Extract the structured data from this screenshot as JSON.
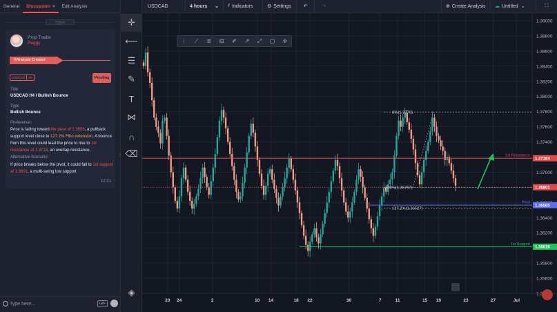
{
  "left_panel": {
    "tabs": [
      {
        "label": "General"
      },
      {
        "label": "Discussion",
        "close": "×"
      },
      {
        "label": "Edit Analysis"
      }
    ],
    "today_label": "TODAY",
    "post": {
      "role": "Prop Trader",
      "author": "Peggy",
      "banner": "Analysis Created",
      "symbol_tag": "USDCAD",
      "tf_tag": "H4",
      "status": "Pending",
      "title_label": "Title",
      "title": "USDCAD H4 I Bullish Bounce",
      "type_label": "Type",
      "type": "Bullish Bounce",
      "preference_label": "Preference:",
      "preference": [
        {
          "t": "Price is failing toward ",
          "c": ""
        },
        {
          "t": "the pivot of 1.3656",
          "c": "hl"
        },
        {
          "t": ", a pullback support level close to ",
          "c": ""
        },
        {
          "t": "127.2% Fibo extension",
          "c": "hl2"
        },
        {
          "t": ". A bounce from this level could lead the price to rise to ",
          "c": ""
        },
        {
          "t": "1st resistance at 1.3718",
          "c": "hl"
        },
        {
          "t": ", an overlap resistance.",
          "c": ""
        }
      ],
      "alt_label": "Alternative Scenario:",
      "alternative": [
        {
          "t": "If price breaks below the pivot, it could fall to ",
          "c": ""
        },
        {
          "t": "1st support at 1.3601",
          "c": "hl"
        },
        {
          "t": ", a multi-swing low support",
          "c": ""
        }
      ],
      "time": "12:21"
    },
    "message_placeholder": "Type here...",
    "gif_label": "GIF"
  },
  "topbar": {
    "symbol": "USDCAD",
    "interval": "4 hours",
    "indicators": "Indicators",
    "settings": "Settings",
    "create": "Create Analysis",
    "untitled": "Untitled"
  },
  "tools": [
    {
      "name": "crosshair-tool-icon",
      "glyph": "✛"
    },
    {
      "name": "horizontal-line-tool-icon",
      "glyph": "⟵"
    },
    {
      "name": "fib-retracement-tool-icon",
      "glyph": "☰"
    },
    {
      "name": "brush-tool-icon",
      "glyph": "✎"
    },
    {
      "name": "text-tool-icon",
      "glyph": "T"
    },
    {
      "name": "pattern-tool-icon",
      "glyph": "⋈"
    },
    {
      "name": "magnet-tool-icon",
      "glyph": "∩"
    },
    {
      "name": "trash-tool-icon",
      "glyph": "🗑"
    },
    {
      "name": "layers-icon",
      "glyph": "◈"
    }
  ],
  "chart_data": {
    "type": "candlestick",
    "symbol": "USDCAD",
    "timeframe": "4 hours",
    "ylim": [
      1.354,
      1.391
    ],
    "y_ticks": [
      "1.39000",
      "1.38800",
      "1.38600",
      "1.38400",
      "1.38200",
      "1.38000",
      "1.37800",
      "1.37600",
      "1.37400",
      "1.37200",
      "1.37000",
      "1.36800",
      "1.36600",
      "1.36400",
      "1.36200",
      "1.36000",
      "1.35800",
      "1.35600",
      "1.35400"
    ],
    "x_ticks": [
      "20",
      "24",
      "2",
      "10",
      "14",
      "18",
      "22",
      "30",
      "7",
      "11",
      "15",
      "19",
      "23",
      "27",
      "Jul"
    ],
    "levels": [
      {
        "label": "1st Resistance",
        "price": 1.37184,
        "price_label": "1.37184",
        "color": "#e04a46"
      },
      {
        "label": "Pivot",
        "price": 1.36565,
        "price_label": "1.36565",
        "color": "#5b6cf5"
      },
      {
        "label": "1st Support",
        "price": 1.36016,
        "price_label": "1.36016",
        "color": "#21c05b"
      }
    ],
    "last_price": {
      "price": 1.36801,
      "price_label": "1.36801",
      "color": "#e04a46"
    },
    "fib": [
      {
        "label": "0%(1.3779)",
        "price": 1.3779
      },
      {
        "label": "100%(1.36797)",
        "price": 1.36797
      },
      {
        "label": "127.2%(1.36527)",
        "price": 1.36527
      }
    ],
    "closes": [
      1.384,
      1.3858,
      1.3832,
      1.3818,
      1.3795,
      1.3772,
      1.376,
      1.3752,
      1.3738,
      1.3768,
      1.3772,
      1.3748,
      1.3722,
      1.37,
      1.368,
      1.3662,
      1.3652,
      1.3668,
      1.3692,
      1.3706,
      1.369,
      1.3674,
      1.3662,
      1.3652,
      1.3658,
      1.3668,
      1.3678,
      1.3692,
      1.3706,
      1.3694,
      1.368,
      1.367,
      1.3688,
      1.3706,
      1.3724,
      1.3746,
      1.3768,
      1.3782,
      1.3772,
      1.3758,
      1.374,
      1.3724,
      1.3708,
      1.369,
      1.3674,
      1.3664,
      1.3668,
      1.3686,
      1.3706,
      1.3726,
      1.3748,
      1.3764,
      1.3752,
      1.3734,
      1.3716,
      1.3698,
      1.3682,
      1.367,
      1.3682,
      1.3698,
      1.3704,
      1.369,
      1.3678,
      1.3666,
      1.3656,
      1.3668,
      1.368,
      1.3692,
      1.3706,
      1.3718,
      1.3704,
      1.369,
      1.3676,
      1.366,
      1.3646,
      1.363,
      1.3616,
      1.3604,
      1.3596,
      1.3608,
      1.3618,
      1.3626,
      1.3614,
      1.3606,
      1.3618,
      1.3632,
      1.3646,
      1.366,
      1.3674,
      1.3688,
      1.3702,
      1.3716,
      1.3708,
      1.3692,
      1.3676,
      1.366,
      1.3648,
      1.364,
      1.3648,
      1.366,
      1.3674,
      1.369,
      1.3704,
      1.3694,
      1.368,
      1.3666,
      1.3652,
      1.3638,
      1.3626,
      1.3616,
      1.3628,
      1.3642,
      1.3656,
      1.3668,
      1.368,
      1.3674,
      1.3684,
      1.369,
      1.37,
      1.3722,
      1.3748,
      1.3768,
      1.376,
      1.3772,
      1.3778,
      1.3766,
      1.3756,
      1.3744,
      1.373,
      1.3712,
      1.3696,
      1.3684,
      1.37,
      1.3716,
      1.3728,
      1.374,
      1.3754,
      1.3772,
      1.376,
      1.3748,
      1.3742,
      1.3734,
      1.3728,
      1.3716,
      1.372,
      1.3712,
      1.3702,
      1.3692,
      1.3682
    ]
  }
}
